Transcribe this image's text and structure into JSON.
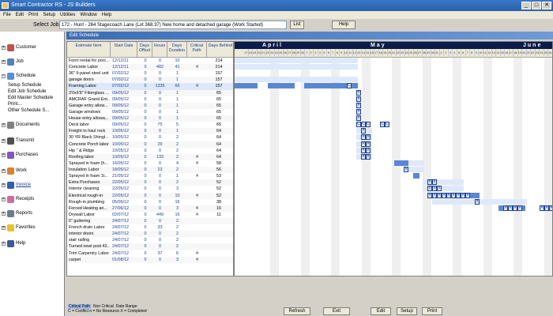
{
  "window": {
    "title": "Smart Contractor RS - JS Builders"
  },
  "menu": [
    "File",
    "Edit",
    "Print",
    "Setup",
    "Utilities",
    "Window",
    "Help"
  ],
  "jobbar": {
    "label": "Select Job:",
    "value": "172 - Hunt - 264 Stagecoach Lane (Lot 368.37)  New home and detached garage   (Work Started)",
    "list": "List",
    "help": "Help"
  },
  "sidebar": {
    "items": [
      {
        "label": "Customer",
        "icon": "customer-icon",
        "color": "#c0504d"
      },
      {
        "label": "Job",
        "icon": "job-icon",
        "color": "#4f81bd"
      },
      {
        "label": "Schedule",
        "icon": "schedule-icon",
        "color": "#5a8fd6"
      },
      {
        "label": "Documents",
        "icon": "documents-icon",
        "color": "#808080"
      },
      {
        "label": "Transmit",
        "icon": "transmit-icon",
        "color": "#505050"
      },
      {
        "label": "Purchases",
        "icon": "purchases-icon",
        "color": "#7e57c2"
      },
      {
        "label": "Work",
        "icon": "work-icon",
        "color": "#d9822b"
      },
      {
        "label": "Invoice",
        "icon": "invoice-icon",
        "color": "#2e5fb0"
      },
      {
        "label": "Receipts",
        "icon": "receipts-icon",
        "color": "#d46a9f"
      },
      {
        "label": "Reports",
        "icon": "reports-icon",
        "color": "#6a7a8c"
      },
      {
        "label": "Favorites",
        "icon": "favorites-icon",
        "color": "#e8c32c"
      },
      {
        "label": "Help",
        "icon": "help-icon",
        "color": "#3b5998"
      }
    ],
    "schedule_sub": [
      "Setup Schedule",
      "Edit Job Schedule",
      "Edit Master Schedule",
      "Print...",
      "Other Schedule S..."
    ]
  },
  "editor": {
    "title": "Edit Schedule",
    "columns": {
      "item": "Estimate Item",
      "date": "Start Date",
      "offset": "Days Offset",
      "hours": "Hours",
      "duration": "Days Duration",
      "critical": "Critical Path",
      "behind": "Days Behind"
    },
    "rows": [
      {
        "item": "Form rental for porc...",
        "date": "12/12/11",
        "offset": "0",
        "hours": "0",
        "duration": "10",
        "critical": "",
        "behind": "214"
      },
      {
        "item": "Concrete Labor",
        "date": "12/12/11",
        "offset": "0",
        "hours": "482",
        "duration": "41",
        "critical": "✕",
        "behind": "214"
      },
      {
        "item": "36\" 9-panel steel unit",
        "date": "07/02/12",
        "offset": "0",
        "hours": "0",
        "duration": "1",
        "critical": "",
        "behind": "157"
      },
      {
        "item": "garage doors",
        "date": "07/02/12",
        "offset": "0",
        "hours": "0",
        "duration": "1",
        "critical": "",
        "behind": "157"
      },
      {
        "item": "Framing Labor",
        "date": "07/02/12",
        "offset": "0",
        "hours": "1335",
        "duration": "66",
        "critical": "✕",
        "behind": "157"
      },
      {
        "item": "3'0x6'8\" Fiberglass ...",
        "date": "09/05/12",
        "offset": "0",
        "hours": "0",
        "duration": "1",
        "critical": "",
        "behind": "65"
      },
      {
        "item": "AMCRAF Grand Ent...",
        "date": "09/05/12",
        "offset": "0",
        "hours": "0",
        "duration": "1",
        "critical": "",
        "behind": "65"
      },
      {
        "item": "Garage entry allow...",
        "date": "09/05/12",
        "offset": "0",
        "hours": "0",
        "duration": "1",
        "critical": "",
        "behind": "65"
      },
      {
        "item": "Garage windows",
        "date": "09/05/12",
        "offset": "0",
        "hours": "0",
        "duration": "1",
        "critical": "",
        "behind": "65"
      },
      {
        "item": "House entry allowa...",
        "date": "09/05/12",
        "offset": "0",
        "hours": "0",
        "duration": "1",
        "critical": "",
        "behind": "65"
      },
      {
        "item": "Deck labor",
        "date": "09/05/12",
        "offset": "0",
        "hours": "75",
        "duration": "5",
        "critical": "",
        "behind": "65"
      },
      {
        "item": "Freight to haul rock",
        "date": "10/05/12",
        "offset": "0",
        "hours": "0",
        "duration": "1",
        "critical": "",
        "behind": "64"
      },
      {
        "item": "30 YR Black Shingl...",
        "date": "10/05/12",
        "offset": "0",
        "hours": "0",
        "duration": "2",
        "critical": "",
        "behind": "64"
      },
      {
        "item": "Concrete Porch labor",
        "date": "10/05/12",
        "offset": "0",
        "hours": "29",
        "duration": "2",
        "critical": "",
        "behind": "64"
      },
      {
        "item": "Hip \" & Ridge",
        "date": "10/05/12",
        "offset": "0",
        "hours": "0",
        "duration": "2",
        "critical": "",
        "behind": "64"
      },
      {
        "item": "Roofing labor",
        "date": "10/05/12",
        "offset": "0",
        "hours": "133",
        "duration": "2",
        "critical": "✕",
        "behind": "64"
      },
      {
        "item": "Sprayed in foam (h...",
        "date": "16/05/12",
        "offset": "0",
        "hours": "0",
        "duration": "4",
        "critical": "✕",
        "behind": "58"
      },
      {
        "item": "Insulation Labor",
        "date": "18/05/12",
        "offset": "0",
        "hours": "23",
        "duration": "2",
        "critical": "",
        "behind": "56"
      },
      {
        "item": "Sprayed in foam 1t...",
        "date": "21/05/12",
        "offset": "0",
        "hours": "0",
        "duration": "1",
        "critical": "✕",
        "behind": "53"
      },
      {
        "item": "Extra Purchases",
        "date": "22/05/12",
        "offset": "0",
        "hours": "0",
        "duration": "2",
        "critical": "",
        "behind": "52"
      },
      {
        "item": "Interior cleaning",
        "date": "22/05/12",
        "offset": "0",
        "hours": "0",
        "duration": "3",
        "critical": "",
        "behind": "52"
      },
      {
        "item": "Electrical rough-in",
        "date": "22/05/12",
        "offset": "0",
        "hours": "0",
        "duration": "10",
        "critical": "✕",
        "behind": "52"
      },
      {
        "item": "Rough-in plumbing",
        "date": "05/06/12",
        "offset": "0",
        "hours": "0",
        "duration": "16",
        "critical": "",
        "behind": "38"
      },
      {
        "item": "Forced Heating an...",
        "date": "27/06/12",
        "offset": "0",
        "hours": "0",
        "duration": "3",
        "critical": "✕",
        "behind": "16"
      },
      {
        "item": "Drywall Labor",
        "date": "02/07/12",
        "offset": "0",
        "hours": "449",
        "duration": "16",
        "critical": "✕",
        "behind": "11"
      },
      {
        "item": "6\" guttering",
        "date": "24/07/12",
        "offset": "0",
        "hours": "0",
        "duration": "2",
        "critical": "",
        "behind": ""
      },
      {
        "item": "French drain Labor",
        "date": "24/07/12",
        "offset": "0",
        "hours": "33",
        "duration": "2",
        "critical": "",
        "behind": ""
      },
      {
        "item": "interior doors",
        "date": "24/07/12",
        "offset": "0",
        "hours": "0",
        "duration": "2",
        "critical": "",
        "behind": ""
      },
      {
        "item": "stair railing",
        "date": "24/07/12",
        "offset": "0",
        "hours": "0",
        "duration": "2",
        "critical": "",
        "behind": ""
      },
      {
        "item": "Turned newl post 42...",
        "date": "24/07/12",
        "offset": "0",
        "hours": "0",
        "duration": "2",
        "critical": "",
        "behind": ""
      },
      {
        "item": "Trim Carpentry Labor",
        "date": "24/07/12",
        "offset": "0",
        "hours": "37",
        "duration": "6",
        "critical": "✕",
        "behind": ""
      },
      {
        "item": "carpet",
        "date": "01/08/12",
        "offset": "0",
        "hours": "0",
        "duration": "3",
        "critical": "✕",
        "behind": ""
      }
    ]
  },
  "gantt": {
    "months": [
      "April",
      "May",
      "June"
    ],
    "days": [
      "17",
      "18",
      "19",
      "20",
      "21",
      "22",
      "23",
      "24",
      "25",
      "26",
      "27",
      "28",
      "29",
      "30",
      "1",
      "2",
      "3",
      "4",
      "5",
      "6",
      "7",
      "8",
      "9",
      "10",
      "11",
      "12",
      "13",
      "14",
      "15",
      "16",
      "17",
      "18",
      "19",
      "20",
      "21",
      "22",
      "23",
      "24",
      "25",
      "26",
      "27",
      "28",
      "29",
      "30",
      "31",
      "1",
      "2",
      "3",
      "4",
      "5",
      "6",
      "7",
      "8",
      "9",
      "10",
      "11",
      "12",
      "13",
      "14",
      "15",
      "16",
      "17",
      "18",
      "19",
      "20",
      "21",
      "22",
      "23",
      "24",
      "25",
      "26",
      "27",
      "28",
      "29",
      "30",
      "31"
    ]
  },
  "legend": {
    "critical": "Critical Path",
    "noncritical": "Non Critical",
    "date_range": "Date Range",
    "key": "C = Conflict   n = No Resource   X = Completed"
  },
  "buttons": {
    "refresh": "Refresh",
    "exit": "Exit",
    "edit": "Edit",
    "setup": "Setup",
    "print": "Print"
  }
}
